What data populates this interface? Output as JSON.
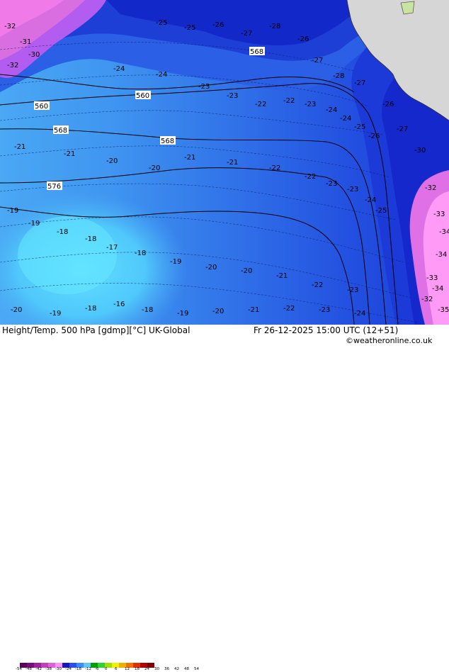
{
  "footer": {
    "title": "Height/Temp. 500 hPa [gdmp][°C] UK-Global",
    "datetime": "Fr 26-12-2025 15:00 UTC (12+51)",
    "credit": "©weatheronline.co.uk"
  },
  "colorbar": {
    "labels": [
      "-54",
      "-48",
      "-42",
      "-38",
      "-30",
      "-24",
      "-18",
      "-12",
      "-6",
      "0",
      "6",
      "12",
      "18",
      "24",
      "30",
      "36",
      "42",
      "48",
      "54"
    ],
    "colors": [
      "#5a005a",
      "#7a0a7a",
      "#a020a0",
      "#c040c0",
      "#e060e0",
      "#ff90ff",
      "#1818c0",
      "#2850f0",
      "#3c8cff",
      "#60c8ff",
      "#00a000",
      "#30d030",
      "#a0e000",
      "#f0f000",
      "#f0b000",
      "#f07000",
      "#e03000",
      "#b00000",
      "#800000"
    ]
  },
  "map": {
    "height_labels": [
      "560",
      "560",
      "568",
      "568",
      "576",
      "568"
    ],
    "temps_far_west": [
      "-32",
      "-31",
      "-32",
      "-30"
    ],
    "temps_north": [
      "-25",
      "-25",
      "-26",
      "-27",
      "-28",
      "-26",
      "-27",
      "-28",
      "-27"
    ],
    "temps_mid": [
      "-24",
      "-24",
      "-23",
      "-23",
      "-22",
      "-22",
      "-23",
      "-24",
      "-24",
      "-25",
      "-26"
    ],
    "temps_center": [
      "-21",
      "-21",
      "-20",
      "-20",
      "-21",
      "-21",
      "-22",
      "-22",
      "-23",
      "-23",
      "-24",
      "-25"
    ],
    "temps_sw": [
      "-19",
      "-19",
      "-18",
      "-18",
      "-17",
      "-18",
      "-19",
      "-20",
      "-20",
      "-21",
      "-22",
      "-23"
    ],
    "temps_south": [
      "-20",
      "-19",
      "-18",
      "-16",
      "-18",
      "-19",
      "-20",
      "-21",
      "-22",
      "-23",
      "-24"
    ],
    "temps_east": [
      "-26",
      "-27",
      "-30",
      "-32",
      "-33",
      "-34",
      "-34",
      "-33",
      "-32",
      "-34",
      "-35"
    ]
  }
}
